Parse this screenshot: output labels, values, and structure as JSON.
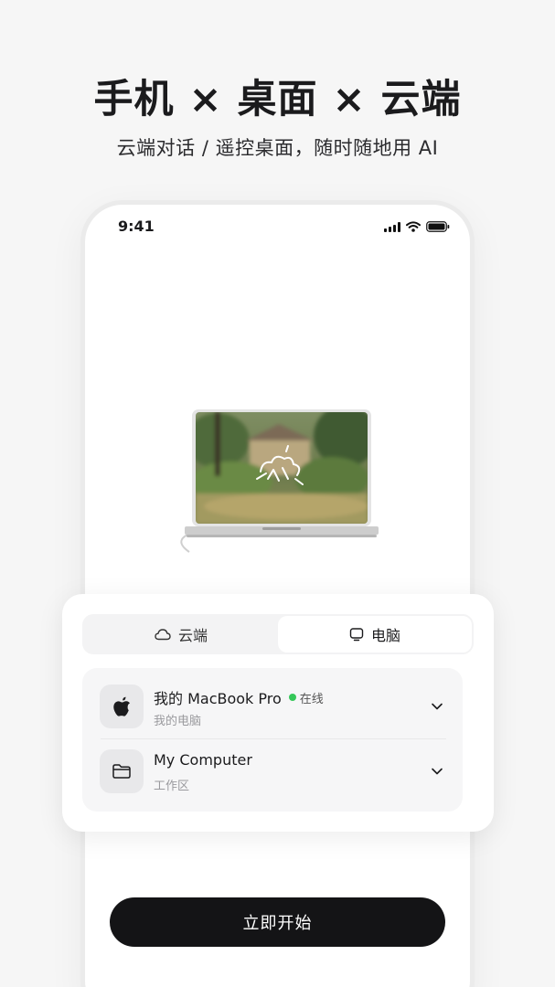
{
  "hero": {
    "title": "手机 × 桌面 × 云端",
    "subtitle": "云端对话 / 遥控桌面，随时随地用 AI"
  },
  "status_bar": {
    "time": "9:41",
    "icons": [
      "signal-icon",
      "wifi-icon",
      "battery-icon"
    ]
  },
  "illustration": {
    "subject": "laptop-with-forest-cottage-wallpaper",
    "logo_icon": "sparkle-cloud-icon"
  },
  "tabs": [
    {
      "label": "云端",
      "icon": "cloud-icon",
      "selected": false
    },
    {
      "label": "电脑",
      "icon": "monitor-icon",
      "selected": true
    }
  ],
  "devices": [
    {
      "name": "我的 MacBook Pro",
      "status": "在线",
      "status_color": "#35c759",
      "subtitle": "我的电脑",
      "icon": "apple-icon"
    },
    {
      "name": "My Computer",
      "subtitle": "工作区",
      "icon": "folder-icon"
    }
  ],
  "cta": {
    "label": "立即开始"
  },
  "colors": {
    "background": "#f6f6f6",
    "primary_button": "#141416",
    "online": "#35c759"
  }
}
